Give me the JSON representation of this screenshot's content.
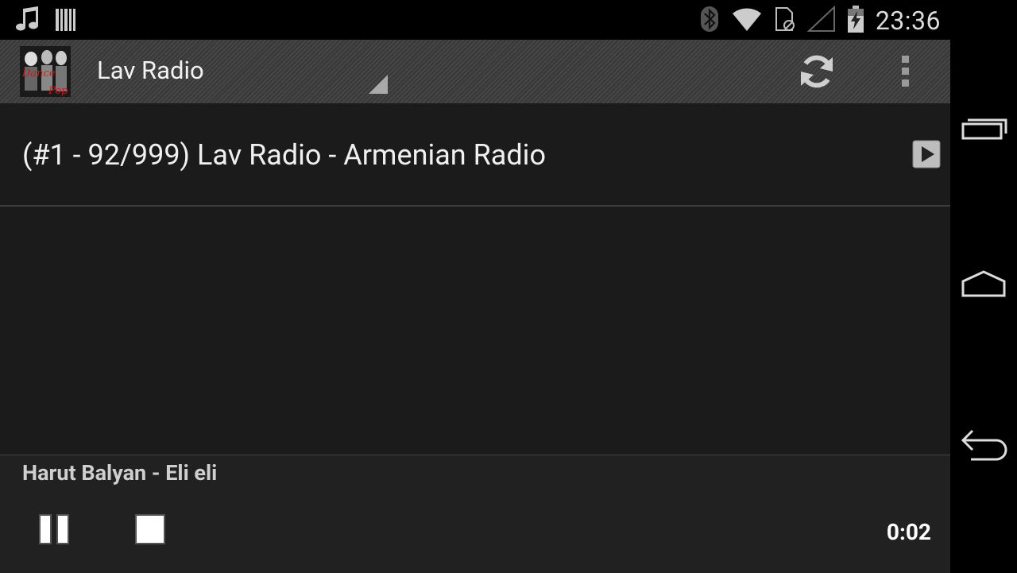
{
  "status_bar": {
    "time": "23:36",
    "left_icons": [
      "music-note-icon",
      "barcode-icon"
    ],
    "right_icons": [
      "bluetooth-icon",
      "wifi-icon",
      "no-sim-icon",
      "cell-signal-icon",
      "battery-charging-icon"
    ]
  },
  "action_bar": {
    "title": "Lav Radio",
    "logo_icon": "album-art-logo",
    "actions": [
      "refresh-icon",
      "overflow-menu-icon"
    ]
  },
  "stations": [
    {
      "label": "(#1 - 92/999) Lav Radio - Armenian Radio",
      "action_icon": "play-icon"
    }
  ],
  "player": {
    "track": "Harut Balyan - Eli eli",
    "elapsed": "0:02",
    "controls": [
      "pause-icon",
      "stop-icon"
    ]
  },
  "nav_bar": {
    "buttons": [
      "recent-apps-icon",
      "home-icon",
      "back-icon"
    ]
  },
  "colors": {
    "content_bg": "#1b1b1b",
    "player_bg": "#212121",
    "action_bar_bg": "#3a3a3a"
  }
}
